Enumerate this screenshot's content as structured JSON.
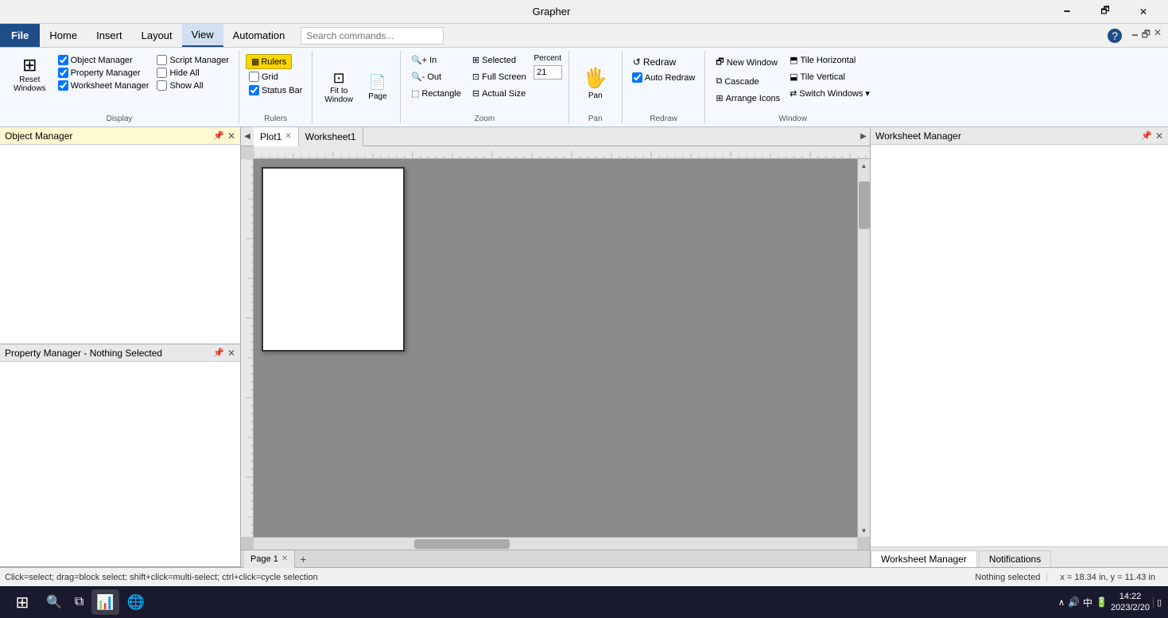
{
  "title_bar": {
    "title": "Grapher",
    "min_btn": "🗕",
    "restore_btn": "🗗",
    "close_btn": "✕"
  },
  "menu": {
    "file_label": "File",
    "items": [
      "Home",
      "Insert",
      "Layout",
      "View",
      "Automation"
    ],
    "active": "View",
    "search_placeholder": "Search commands...",
    "help_icon": "?"
  },
  "ribbon": {
    "groups": {
      "display": {
        "label": "Display",
        "reset_label": "Reset\nWindows",
        "checkboxes": [
          {
            "id": "obj",
            "label": "Object Manager",
            "checked": true
          },
          {
            "id": "prop",
            "label": "Property Manager",
            "checked": true
          },
          {
            "id": "script",
            "label": "Script Manager",
            "checked": false
          },
          {
            "id": "hide",
            "label": "Hide All",
            "checked": false
          },
          {
            "id": "worksheet",
            "label": "Worksheet Manager",
            "checked": true
          },
          {
            "id": "show",
            "label": "Show All",
            "checked": false
          }
        ]
      },
      "rulers": {
        "label": "Rulers",
        "grid_label": "Grid",
        "status_label": "Status Bar"
      },
      "fit": {
        "label": "Fit to Window"
      },
      "page": {
        "label": "Page"
      },
      "zoom": {
        "label": "Zoom",
        "in_label": "In",
        "out_label": "Out",
        "rectangle_label": "Rectangle",
        "percent_label": "Percent",
        "percent_value": "21",
        "selected_label": "Selected",
        "full_screen_label": "Full Screen",
        "actual_size_label": "Actual Size"
      },
      "pan": {
        "label": "Pan"
      },
      "redraw": {
        "label": "Redraw",
        "redraw_btn": "Redraw",
        "auto_redraw_label": "Auto Redraw"
      },
      "window": {
        "label": "Window",
        "new_window_label": "New Window",
        "cascade_label": "Cascade",
        "arrange_icons_label": "Arrange Icons",
        "tile_horizontal_label": "Tile Horizontal",
        "tile_vertical_label": "Tile Vertical",
        "switch_windows_label": "Switch Windows"
      }
    }
  },
  "tabs": {
    "left_arrow": "◀",
    "right_arrow": "▶",
    "tabs": [
      {
        "label": "Plot1",
        "active": true
      },
      {
        "label": "Worksheet1",
        "active": false
      }
    ]
  },
  "panels": {
    "object_manager": {
      "title": "Object Manager",
      "pin": "📌",
      "close": "✕"
    },
    "property_manager": {
      "title": "Property Manager - Nothing Selected",
      "pin": "📌",
      "close": "✕"
    },
    "worksheet_manager": {
      "title": "Worksheet Manager",
      "pin": "📌",
      "close": "✕"
    }
  },
  "page_tabs": {
    "tabs": [
      {
        "label": "Page 1"
      }
    ],
    "add_label": "+"
  },
  "right_tabs": {
    "tabs": [
      {
        "label": "Worksheet Manager",
        "active": true
      },
      {
        "label": "Notifications",
        "active": false
      }
    ]
  },
  "status": {
    "left_text": "Click=select; drag=block select; shift+click=multi-select; ctrl+click=cycle selection",
    "middle_text": "Nothing selected",
    "right_text": "x = 18.34 in, y = 11.43 in"
  },
  "taskbar": {
    "start_icon": "⊞",
    "search_icon": "🔍",
    "task_view": "⧉",
    "browser_icon": "🌐",
    "time": "14:22",
    "date": "2023/2/20",
    "system_tray": "⌂ 🔊 中",
    "show_desktop": "▯"
  }
}
